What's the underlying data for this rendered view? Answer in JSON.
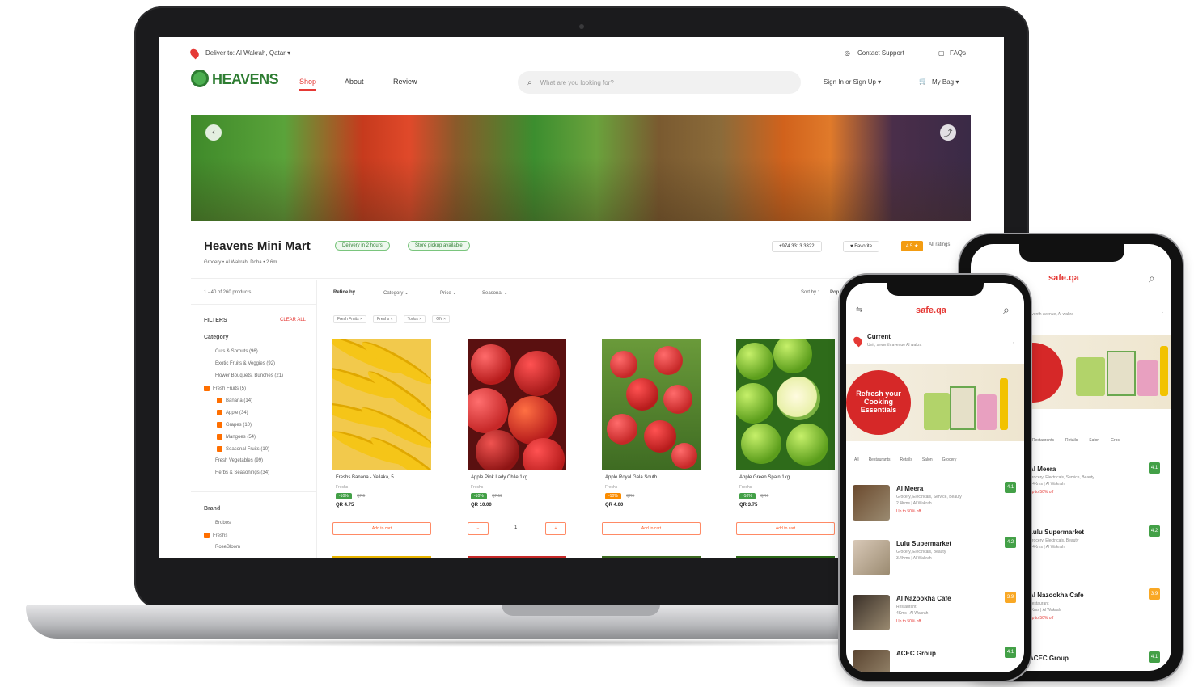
{
  "laptop": {
    "topbar": {
      "deliver": "Deliver to: Al Wakrah, Qatar ▾",
      "support": "Contact Support",
      "faqs": "FAQs"
    },
    "header": {
      "logo": "HEAVENS",
      "nav": [
        "Shop",
        "About",
        "Review"
      ],
      "search_placeholder": "What are you looking for?",
      "signin": "Sign In or Sign Up ▾",
      "bag": "My Bag ▾"
    },
    "store": {
      "name": "Heavens Mini Mart",
      "chips": [
        "Delivery in 2 hours",
        "Store pickup available"
      ],
      "breadcrumb": "Grocery  •  Al Wakrah, Doha  •  2.6m",
      "phone": "+974 3313 3322",
      "favorite": "♥ Favorite",
      "rating": "4.5 ★",
      "rating_label": "All ratings"
    },
    "toolbar": {
      "count": "1 - 40 of 260 products",
      "refine": "Refine by",
      "filters": [
        "Category ⌄",
        "Price ⌄",
        "Seasonal ⌄"
      ],
      "sort": "Sort by :",
      "sort_value": "Pop"
    },
    "active_tags": [
      "Fresh Fruits ×",
      "Freshs ×",
      "Todos ×",
      "ON ×"
    ],
    "sidebar": {
      "filters": "FILTERS",
      "clear": "CLEAR ALL",
      "category": "Category",
      "categories": [
        {
          "label": "Cuts & Sprouts (96)",
          "checked": false,
          "indent": false
        },
        {
          "label": "Exotic Fruits & Veggies (92)",
          "checked": false,
          "indent": false
        },
        {
          "label": "Flower Bouquets, Bunches (21)",
          "checked": false,
          "indent": false
        },
        {
          "label": "Fresh Fruits (5)",
          "checked": true,
          "indent": false
        },
        {
          "label": "Banana (14)",
          "checked": true,
          "indent": true
        },
        {
          "label": "Apple (34)",
          "checked": true,
          "indent": true
        },
        {
          "label": "Grapes (10)",
          "checked": true,
          "indent": true
        },
        {
          "label": "Mangoes (54)",
          "checked": true,
          "indent": true
        },
        {
          "label": "Seasonal Fruits (10)",
          "checked": true,
          "indent": true
        },
        {
          "label": "Fresh Vegetables (99)",
          "checked": false,
          "indent": false
        },
        {
          "label": "Herbs & Seasonings (34)",
          "checked": false,
          "indent": false
        }
      ],
      "brand": "Brand",
      "brands": [
        {
          "label": "Brobos",
          "checked": false
        },
        {
          "label": "Freshs",
          "checked": true
        },
        {
          "label": "RoseBloom",
          "checked": false
        }
      ]
    },
    "products": [
      {
        "name": "Freshs Banana - Yellaka, 5...",
        "brand": "Freshs",
        "tag": "-10%",
        "was": "QR5",
        "price": "QR 4.75",
        "tag_color": "#43a047",
        "action": "Add to cart"
      },
      {
        "name": "Apple Pink Lady Chile 1kg",
        "brand": "Freshs",
        "tag": "-10%",
        "was": "QR11",
        "price": "QR 10.00",
        "tag_color": "#43a047",
        "action": "stepper",
        "qty": "1"
      },
      {
        "name": "Apple Royal Gala South...",
        "brand": "Freshs",
        "tag": "-10%",
        "was": "QR5",
        "price": "QR 4.00",
        "tag_color": "#fb8c00",
        "action": "Add to cart"
      },
      {
        "name": "Apple Green Spain 1kg",
        "brand": "Freshs",
        "tag": "-10%",
        "was": "QR6",
        "price": "QR 3.75",
        "tag_color": "#43a047",
        "action": "Add to cart"
      }
    ]
  },
  "phone_front": {
    "logo": "safe.qa",
    "location_title": "Current",
    "location_sub": "Unit, seventh avenue Al wakra",
    "banner": "Refresh your Cooking Essentials",
    "tabs": [
      "All",
      "Restaurants",
      "Retails",
      "Salon",
      "Grocery"
    ],
    "stores": [
      {
        "name": "Al Meera",
        "sub": "Grocery, Electricals, Service, Beauty",
        "meta": "2.4Kms  |  Al Wakrah",
        "offer": "Up to 50% off",
        "badge": "4.1",
        "badge_color": "#43a047"
      },
      {
        "name": "Lulu Supermarket",
        "sub": "Grocery, Electricals, Beauty",
        "meta": "3.4Kms  |  Al Wakrah",
        "offer": "",
        "badge": "4.2",
        "badge_color": "#43a047"
      },
      {
        "name": "Al Nazookha Cafe",
        "sub": "Restaurant",
        "meta": "4Kms  |  Al Wakrah",
        "offer": "Up to 50% off",
        "badge": "3.9",
        "badge_color": "#f9a825"
      },
      {
        "name": "ACEC Group",
        "sub": "",
        "meta": "",
        "offer": "",
        "badge": "4.1",
        "badge_color": "#43a047"
      }
    ]
  },
  "phone_back": {
    "logo": "safe.qa",
    "location_sub": "seventh avenue, Al wakra",
    "tabs": [
      "Restaurants",
      "Retails",
      "Salon",
      "Groc"
    ],
    "stores": [
      {
        "name": "Al Meera",
        "sub": "Grocery, Electricals, Service, Beauty",
        "meta": "2.4Kms  |  Al Wakrah",
        "offer": "Up to 50% off",
        "badge": "4.1",
        "badge_color": "#43a047"
      },
      {
        "name": "Lulu Supermarket",
        "sub": "Grocery, Electricals, Beauty",
        "meta": "3.4Kms  |  Al Wakrah",
        "offer": "",
        "badge": "4.2",
        "badge_color": "#43a047"
      },
      {
        "name": "Al Nazookha Cafe",
        "sub": "Restaurant",
        "meta": "4Kms  |  Al Wakrah",
        "offer": "Up to 50% off",
        "badge": "3.9",
        "badge_color": "#f9a825"
      },
      {
        "name": "ACEC Group",
        "sub": "",
        "meta": "",
        "offer": "",
        "badge": "4.1",
        "badge_color": "#43a047"
      }
    ]
  },
  "colors": {
    "accent": "#e53935",
    "orange": "#ff6f00",
    "green": "#2e7d32"
  }
}
